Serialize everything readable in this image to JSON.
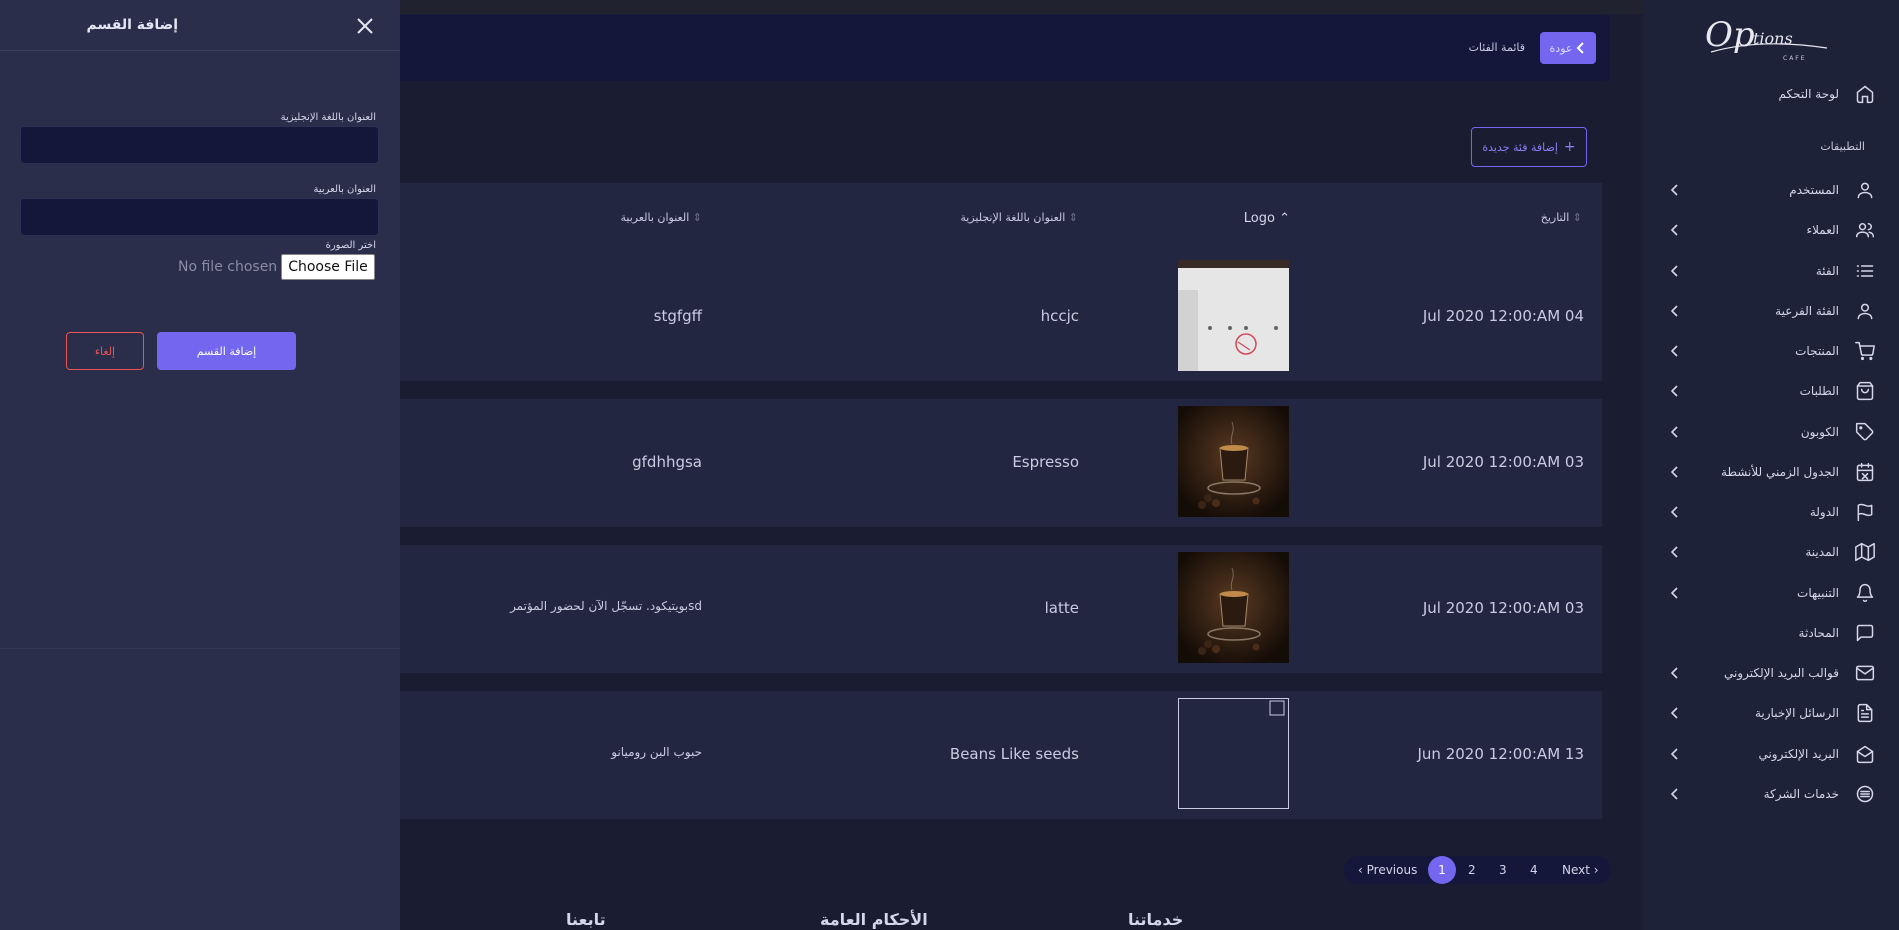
{
  "sidebar": {
    "logo_text": "Options CAFE",
    "dashboard_label": "لوحة التحكم",
    "section_title": "التطبيقات",
    "items": [
      {
        "label": "المستخدم",
        "icon": "user-icon"
      },
      {
        "label": "العملاء",
        "icon": "users-icon"
      },
      {
        "label": "الفئة",
        "icon": "list-icon"
      },
      {
        "label": "الفئة الفرعية",
        "icon": "user-icon"
      },
      {
        "label": "المنتجات",
        "icon": "cart-icon"
      },
      {
        "label": "الطلبات",
        "icon": "bag-icon"
      },
      {
        "label": "الكوبون",
        "icon": "tag-icon"
      },
      {
        "label": "الجدول الزمني للأنشطة",
        "icon": "calendar-icon"
      },
      {
        "label": "الدولة",
        "icon": "flag-icon"
      },
      {
        "label": "المدينة",
        "icon": "map-icon"
      },
      {
        "label": "التنبيهات",
        "icon": "bell-icon"
      },
      {
        "label": "المحادثة",
        "icon": "chat-icon"
      },
      {
        "label": "قوالب البريد الإلكتروني",
        "icon": "mail-icon"
      },
      {
        "label": "الرسائل الإخبارية",
        "icon": "document-icon"
      },
      {
        "label": "البريد الإلكتروني",
        "icon": "envelope-open-icon"
      },
      {
        "label": "خدمات الشركة",
        "icon": "services-icon"
      }
    ]
  },
  "header": {
    "back_label": "عودة",
    "breadcrumb": "قائمة الفئات"
  },
  "add_category_label": "إضافة فئة جديدة",
  "table": {
    "columns": {
      "date": "التاريخ",
      "logo": "Logo",
      "title_en": "العنوان باللغة الإنجليزية",
      "title_ar": "العنوان بالعربية"
    },
    "rows": [
      {
        "date": "Jul 2020 12:00:AM 04",
        "title_en": "hccjc",
        "title_ar": "stgfgff",
        "image": "screenshot"
      },
      {
        "date": "Jul 2020 12:00:AM 03",
        "title_en": "Espresso",
        "title_ar": "gfdhhgsa",
        "image": "coffee"
      },
      {
        "date": "Jul 2020 12:00:AM 03",
        "title_en": "latte",
        "title_ar": "بويتيكود. تسجّل الآن لحضور المؤتمرsd",
        "image": "coffee"
      },
      {
        "date": "Jun 2020 12:00:AM 13",
        "title_en": "Beans Like seeds",
        "title_ar": "حبوب البن روميانو",
        "image": "broken"
      }
    ]
  },
  "pagination": {
    "previous": "Previous",
    "pages": [
      "1",
      "2",
      "3",
      "4"
    ],
    "active": "1",
    "next": "Next"
  },
  "footer": {
    "services": "خدماتنا",
    "terms": "الأحكام العامة",
    "follow": "تابعنا"
  },
  "drawer": {
    "title": "إضافة القسم",
    "title_en_label": "العنوان باللغة الإنجليزية",
    "title_ar_label": "العنوان بالعربية",
    "image_label": "اختر الصورة",
    "no_file": "No file chosen",
    "choose_file": "Choose File",
    "cancel": "إلغاء",
    "submit": "إضافة القسم"
  },
  "colors": {
    "accent": "#7367f0",
    "danger": "#ea5455",
    "background": "#1a1d31",
    "card": "#232640"
  }
}
